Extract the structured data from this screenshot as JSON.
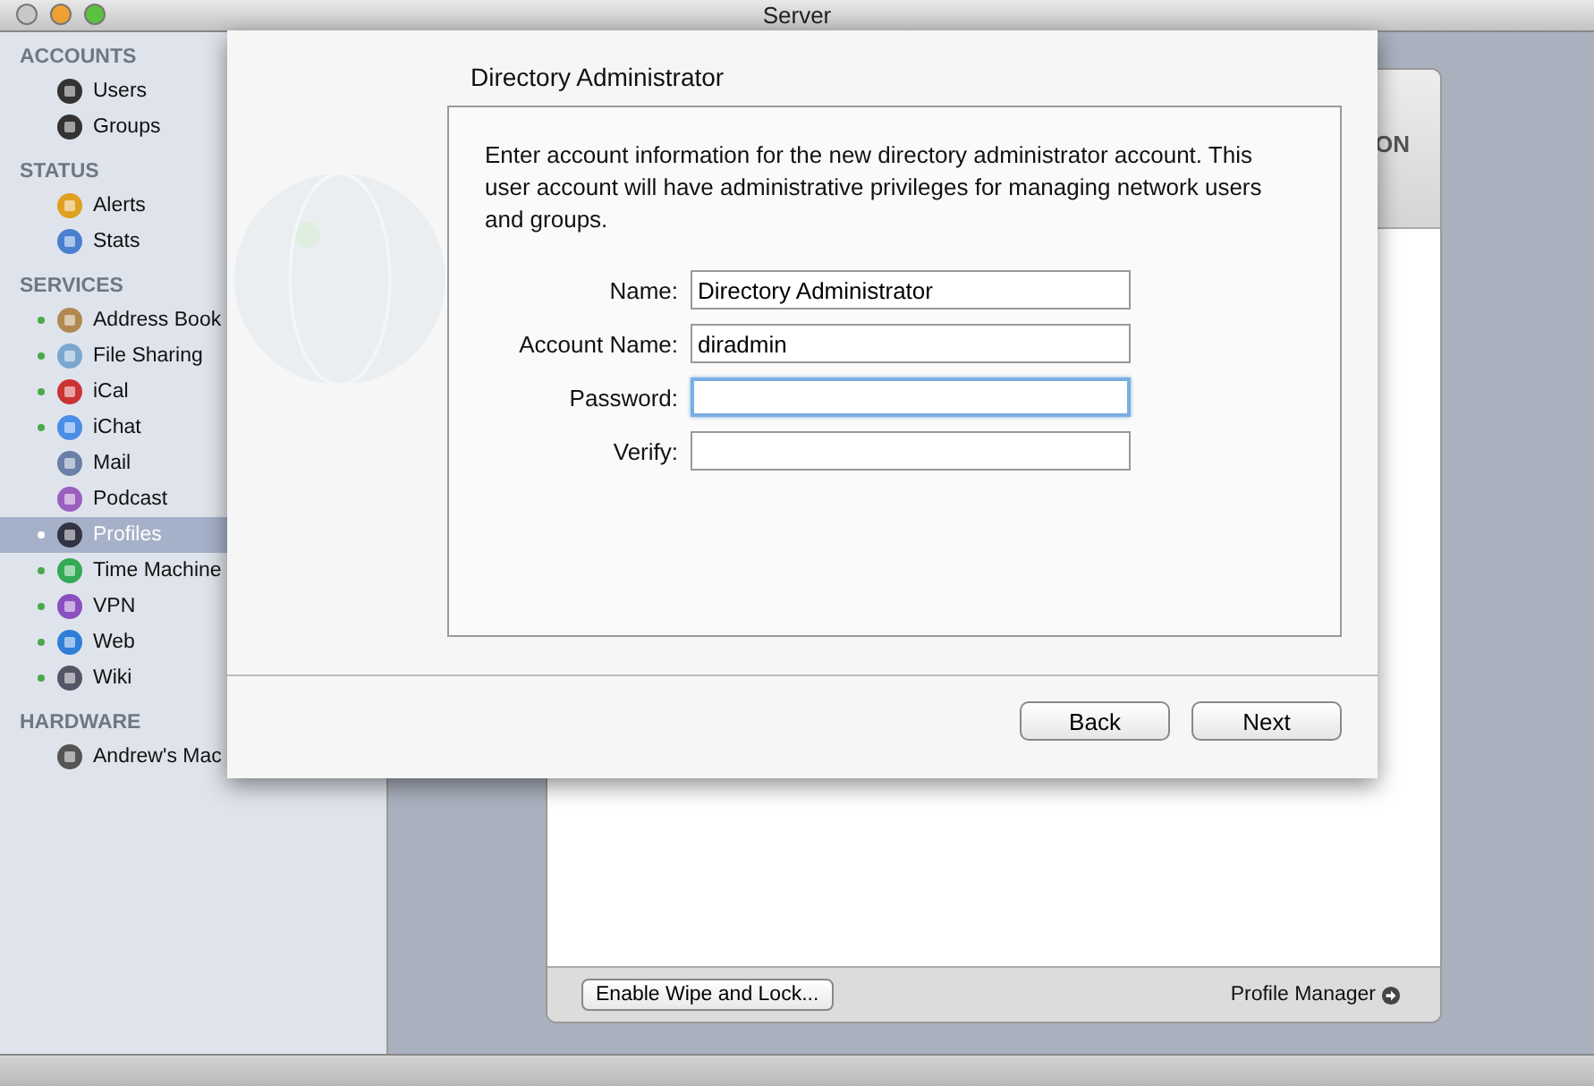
{
  "window": {
    "title": "Server"
  },
  "sidebar": {
    "sections": [
      {
        "heading": "ACCOUNTS",
        "items": [
          {
            "label": "Users",
            "kind": "plain",
            "selected": false
          },
          {
            "label": "Groups",
            "kind": "plain",
            "selected": false
          }
        ]
      },
      {
        "heading": "STATUS",
        "items": [
          {
            "label": "Alerts",
            "kind": "plain",
            "selected": false
          },
          {
            "label": "Stats",
            "kind": "plain",
            "selected": false
          }
        ]
      },
      {
        "heading": "SERVICES",
        "items": [
          {
            "label": "Address Book",
            "kind": "service",
            "running": true,
            "selected": false
          },
          {
            "label": "File Sharing",
            "kind": "service",
            "running": true,
            "selected": false
          },
          {
            "label": "iCal",
            "kind": "service",
            "running": true,
            "selected": false
          },
          {
            "label": "iChat",
            "kind": "service",
            "running": true,
            "selected": false
          },
          {
            "label": "Mail",
            "kind": "service",
            "running": false,
            "selected": false
          },
          {
            "label": "Podcast",
            "kind": "service",
            "running": false,
            "selected": false
          },
          {
            "label": "Profiles",
            "kind": "service",
            "running": true,
            "selected": true
          },
          {
            "label": "Time Machine",
            "kind": "service",
            "running": true,
            "selected": false
          },
          {
            "label": "VPN",
            "kind": "service",
            "running": true,
            "selected": false
          },
          {
            "label": "Web",
            "kind": "service",
            "running": true,
            "selected": false
          },
          {
            "label": "Wiki",
            "kind": "service",
            "running": true,
            "selected": false
          }
        ]
      },
      {
        "heading": "HARDWARE",
        "items": [
          {
            "label": "Andrew's Mac",
            "kind": "plain",
            "selected": false
          }
        ]
      }
    ]
  },
  "panel": {
    "heading_fragment": "ON",
    "footer": {
      "button": "Enable Wipe and Lock...",
      "link": "Profile Manager"
    }
  },
  "sheet": {
    "title": "Directory Administrator",
    "description": "Enter account information for the new directory administrator account. This user account will have administrative privileges for managing network users and groups.",
    "fields": [
      {
        "label": "Name:",
        "value": "Directory Administrator",
        "focused": false
      },
      {
        "label": "Account Name:",
        "value": "diradmin",
        "focused": false
      },
      {
        "label": "Password:",
        "focused": true
      },
      {
        "label": "Verify:",
        "focused": false
      }
    ],
    "buttons": [
      "Back",
      "Next"
    ]
  }
}
